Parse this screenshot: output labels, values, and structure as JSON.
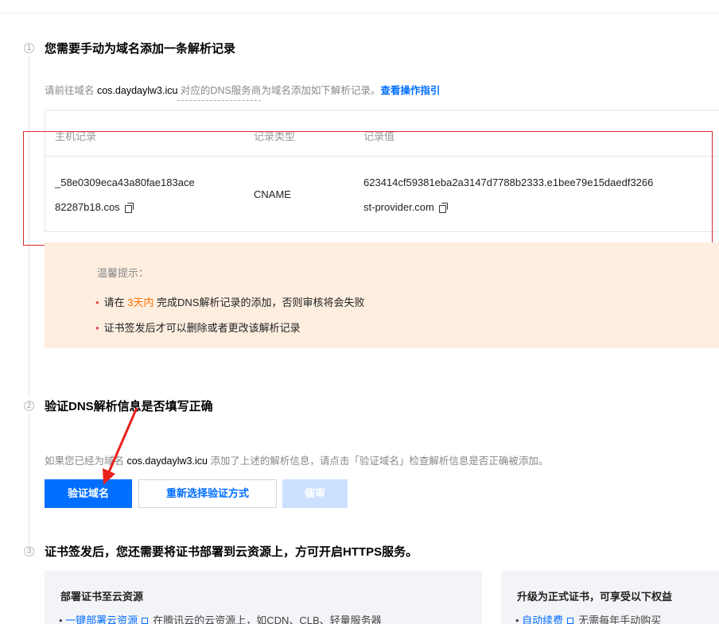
{
  "step1": {
    "number": "1",
    "title": "您需要手动为域名添加一条解析记录",
    "desc_prefix": "请前往域名 ",
    "domain": "cos.daydaylw3.icu",
    "desc_mid": " 对应的DNS服务商",
    "desc_suffix": "为域名添加如下解析记录。",
    "guide_link": "查看操作指引"
  },
  "dns_table": {
    "headers": [
      "主机记录",
      "记录类型",
      "记录值"
    ],
    "row": {
      "host_line1": "_58e0309eca43a80fae183ace",
      "host_line2": "82287b18.cos",
      "type": "CNAME",
      "value_line1": "623414cf59381eba2a3147d7788b2333.e1bee79e15daedf3266",
      "value_line2": "st-provider.com"
    }
  },
  "notice": {
    "title": "温馨提示：",
    "item1_prefix": "请在 ",
    "item1_highlight": "3天内",
    "item1_suffix": " 完成DNS解析记录的添加，否则审核将会失败",
    "item2": "证书签发后才可以删除或者更改该解析记录"
  },
  "step2": {
    "number": "2",
    "title": "验证DNS解析信息是否填写正确",
    "desc_prefix": "如果您已经为域名 ",
    "domain": "cos.daydaylw3.icu",
    "desc_suffix": " 添加了上述的解析信息，请点击「验证域名」检查解析信息是否正确被添加。",
    "btn_verify": "验证域名",
    "btn_reselect": "重新选择验证方式",
    "btn_urge": "催审"
  },
  "step3": {
    "number": "3",
    "title": "证书签发后，您还需要将证书部署到云资源上，方可开启HTTPS服务。",
    "card_left": {
      "title": "部署证书至云资源",
      "link": "一键部署云资源",
      "text": "在腾讯云的云资源上，如CDN、CLB、轻量服务器"
    },
    "card_right": {
      "title": "升级为正式证书，可享受以下权益",
      "link": "自动续费",
      "text": "无需每年手动购买"
    }
  },
  "colors": {
    "primary": "#006eff",
    "highlight_box": "#d62b2b",
    "arrow": "#e8231d",
    "notice_bg": "#fdeee0",
    "warning": "#ff7200"
  }
}
